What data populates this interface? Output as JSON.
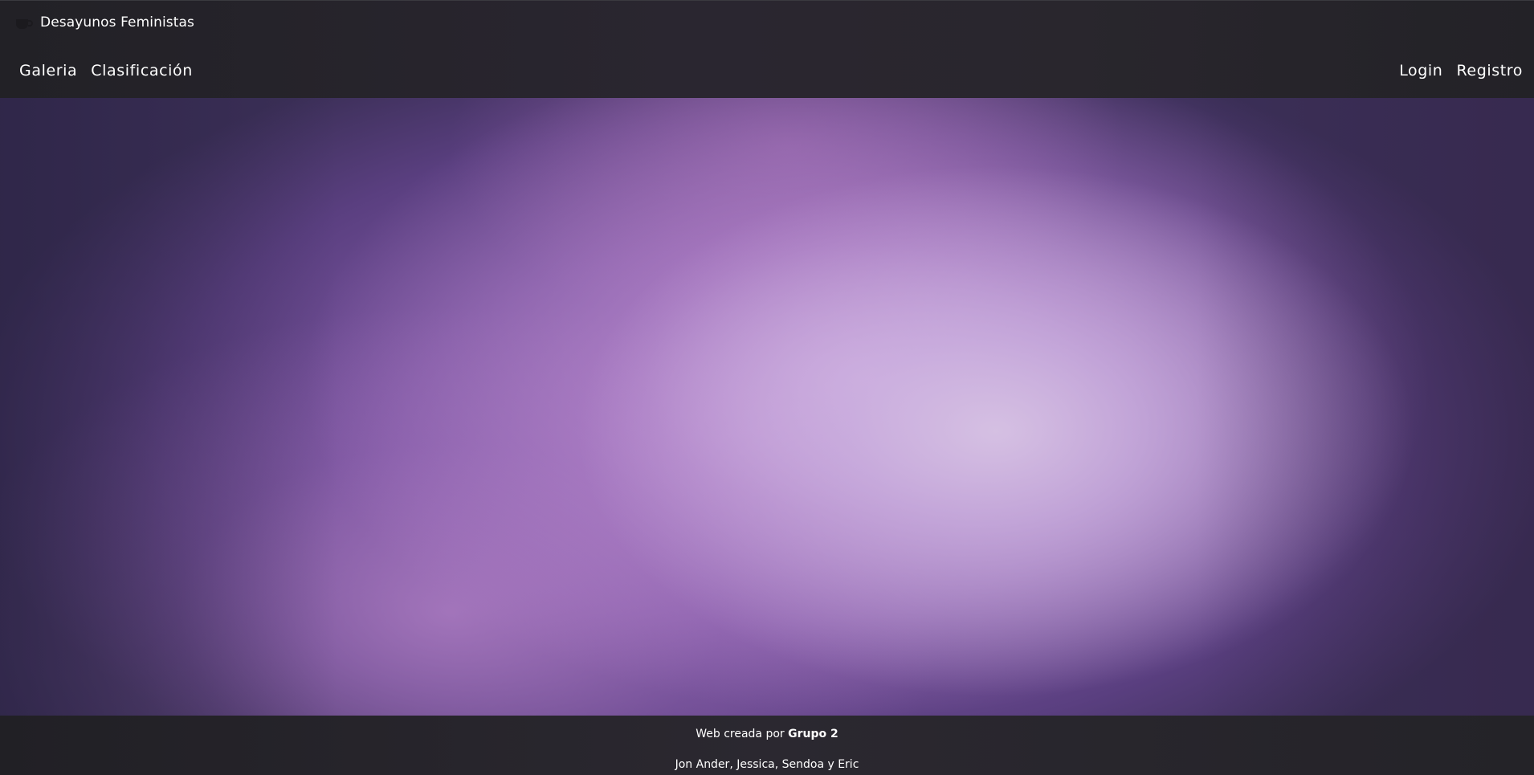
{
  "brand": {
    "icon": "coffee-cup-icon",
    "title": "Desayunos Feministas"
  },
  "nav": {
    "left": [
      {
        "label": "Galeria"
      },
      {
        "label": "Clasificación"
      }
    ],
    "right": [
      {
        "label": "Login"
      },
      {
        "label": "Registro"
      }
    ]
  },
  "footer": {
    "credit_prefix": "Web creada por",
    "credit_group": "Grupo 2",
    "authors": "Jon Ander, Jessica, Sendoa y Eric"
  },
  "colors": {
    "navbar_bg": "#252329",
    "footer_bg": "#28262c",
    "hero_center": "#d2b6de",
    "hero_edge": "#3b2f57",
    "text": "#ffffff"
  }
}
